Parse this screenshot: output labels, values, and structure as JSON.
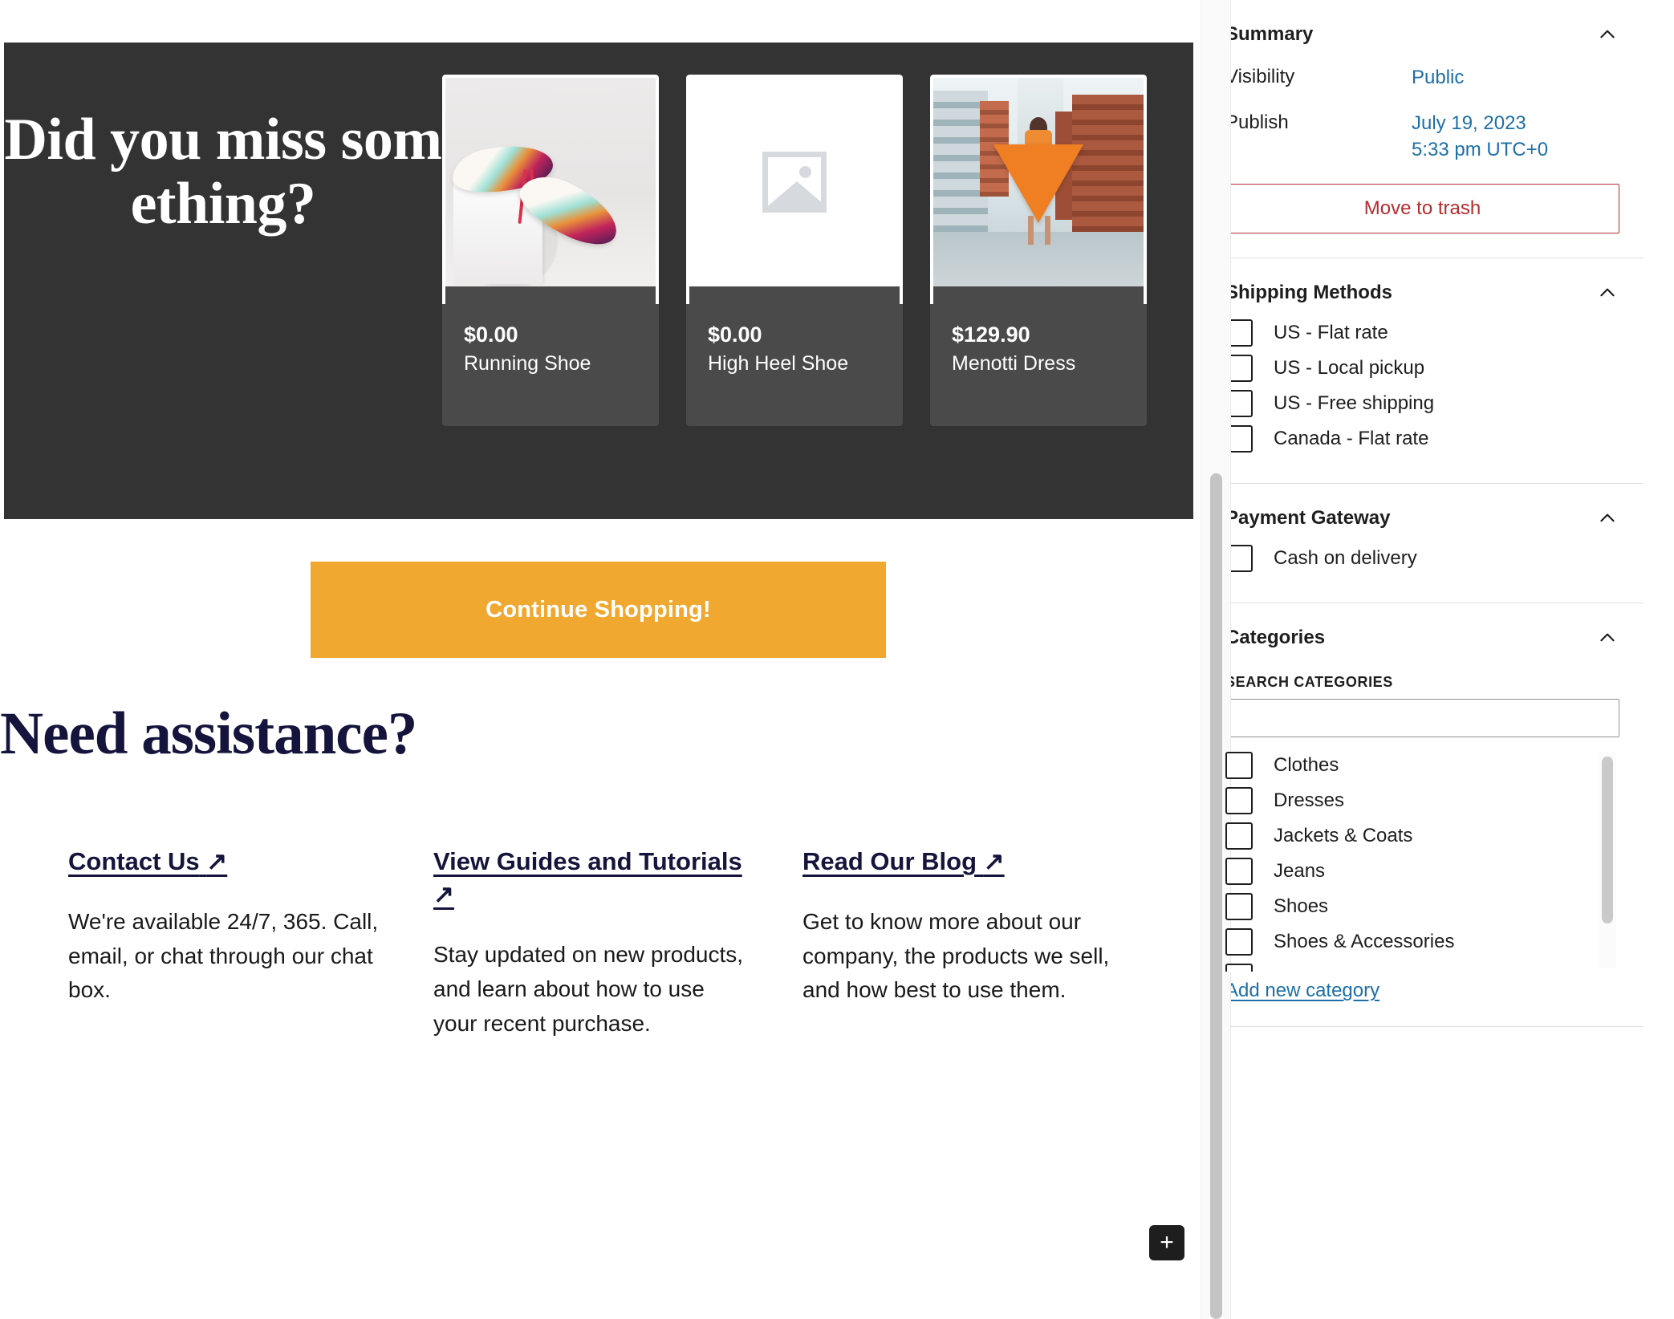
{
  "hero": {
    "heading": "Did you miss something?",
    "products": [
      {
        "price": "$0.00",
        "title": "Running Shoe",
        "art": "running-shoe-photo"
      },
      {
        "price": "$0.00",
        "title": "High Heel Shoe",
        "art": "image-placeholder-icon"
      },
      {
        "price": "$129.90",
        "title": "Menotti Dress",
        "art": "dress-street-photo"
      }
    ]
  },
  "cta": {
    "label": "Continue Shopping!",
    "color": "#f0a830"
  },
  "assistance": {
    "heading": "Need assistance?",
    "columns": [
      {
        "link": "Contact Us",
        "arrow": "↗",
        "body": "We're available 24/7, 365. Call, email, or chat through our chat box."
      },
      {
        "link": "View Guides and Tutorials",
        "arrow": "↗",
        "body": "Stay updated on new products, and learn about how to use your recent purchase."
      },
      {
        "link": "Read Our Blog",
        "arrow": "↗",
        "body": "Get to know more about our company, the products we sell, and how best to use them."
      }
    ]
  },
  "add_block_button": {
    "label": "+"
  },
  "sidebar": {
    "summary": {
      "title": "Summary",
      "visibility_label": "Visibility",
      "visibility_value": "Public",
      "publish_label": "Publish",
      "publish_date": "July 19, 2023",
      "publish_time": "5:33 pm UTC+0",
      "trash_label": "Move to trash",
      "trash_color": "#b32d2e"
    },
    "shipping": {
      "title": "Shipping Methods",
      "options": [
        {
          "label": "US - Flat rate",
          "checked": false
        },
        {
          "label": "US - Local pickup",
          "checked": false
        },
        {
          "label": "US - Free shipping",
          "checked": false
        },
        {
          "label": "Canada - Flat rate",
          "checked": false
        }
      ]
    },
    "payment": {
      "title": "Payment Gateway",
      "options": [
        {
          "label": "Cash on delivery",
          "checked": false
        }
      ]
    },
    "categories": {
      "title": "Categories",
      "search_label": "SEARCH CATEGORIES",
      "search_value": "",
      "search_placeholder": "",
      "options": [
        {
          "label": "Clothes",
          "checked": false
        },
        {
          "label": "Dresses",
          "checked": false
        },
        {
          "label": "Jackets & Coats",
          "checked": false
        },
        {
          "label": "Jeans",
          "checked": false
        },
        {
          "label": "Shoes",
          "checked": false
        },
        {
          "label": "Shoes & Accessories",
          "checked": false
        }
      ],
      "add_link": "Add new category"
    }
  }
}
